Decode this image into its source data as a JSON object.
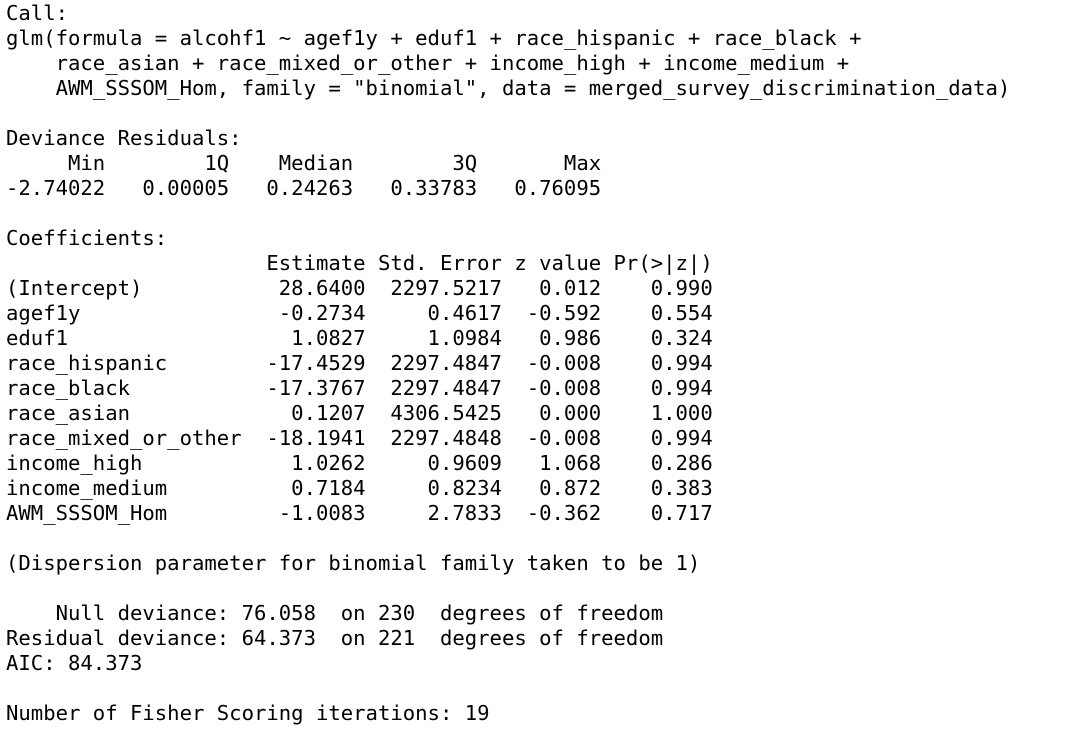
{
  "colors": {
    "background": "#ffffff",
    "text": "#000000"
  },
  "call": {
    "header": "Call:",
    "lines": [
      "glm(formula = alcohf1 ~ agef1y + eduf1 + race_hispanic + race_black + ",
      "    race_asian + race_mixed_or_other + income_high + income_medium + ",
      "    AWM_SSSOM_Hom, family = \"binomial\", data = merged_survey_discrimination_data)"
    ]
  },
  "deviance_residuals": {
    "header": "Deviance Residuals: ",
    "labels_line": "     Min        1Q    Median        3Q       Max  ",
    "values_line": "-2.74022   0.00005   0.24263   0.33783   0.76095  ",
    "labels": [
      "Min",
      "1Q",
      "Median",
      "3Q",
      "Max"
    ],
    "values": [
      "-2.74022",
      "0.00005",
      "0.24263",
      "0.33783",
      "0.76095"
    ]
  },
  "coefficients": {
    "header": "Coefficients:",
    "columns_line": "                     Estimate Std. Error z value Pr(>|z|)",
    "columns": [
      "Estimate",
      "Std. Error",
      "z value",
      "Pr(>|z|)"
    ],
    "rows": [
      {
        "line": "(Intercept)           28.6400  2297.5217   0.012    0.990",
        "term": "(Intercept)",
        "estimate": "28.6400",
        "std_error": "2297.5217",
        "z_value": "0.012",
        "p_value": "0.990"
      },
      {
        "line": "agef1y                -0.2734     0.4617  -0.592    0.554",
        "term": "agef1y",
        "estimate": "-0.2734",
        "std_error": "0.4617",
        "z_value": "-0.592",
        "p_value": "0.554"
      },
      {
        "line": "eduf1                  1.0827     1.0984   0.986    0.324",
        "term": "eduf1",
        "estimate": "1.0827",
        "std_error": "1.0984",
        "z_value": "0.986",
        "p_value": "0.324"
      },
      {
        "line": "race_hispanic        -17.4529  2297.4847  -0.008    0.994",
        "term": "race_hispanic",
        "estimate": "-17.4529",
        "std_error": "2297.4847",
        "z_value": "-0.008",
        "p_value": "0.994"
      },
      {
        "line": "race_black           -17.3767  2297.4847  -0.008    0.994",
        "term": "race_black",
        "estimate": "-17.3767",
        "std_error": "2297.4847",
        "z_value": "-0.008",
        "p_value": "0.994"
      },
      {
        "line": "race_asian             0.1207  4306.5425   0.000    1.000",
        "term": "race_asian",
        "estimate": "0.1207",
        "std_error": "4306.5425",
        "z_value": "0.000",
        "p_value": "1.000"
      },
      {
        "line": "race_mixed_or_other  -18.1941  2297.4848  -0.008    0.994",
        "term": "race_mixed_or_other",
        "estimate": "-18.1941",
        "std_error": "2297.4848",
        "z_value": "-0.008",
        "p_value": "0.994"
      },
      {
        "line": "income_high            1.0262     0.9609   1.068    0.286",
        "term": "income_high",
        "estimate": "1.0262",
        "std_error": "0.9609",
        "z_value": "1.068",
        "p_value": "0.286"
      },
      {
        "line": "income_medium          0.7184     0.8234   0.872    0.383",
        "term": "income_medium",
        "estimate": "0.7184",
        "std_error": "0.8234",
        "z_value": "0.872",
        "p_value": "0.383"
      },
      {
        "line": "AWM_SSSOM_Hom         -1.0083     2.7833  -0.362    0.717",
        "term": "AWM_SSSOM_Hom",
        "estimate": "-1.0083",
        "std_error": "2.7833",
        "z_value": "-0.362",
        "p_value": "0.717"
      }
    ]
  },
  "dispersion_note": "(Dispersion parameter for binomial family taken to be 1)",
  "fit": {
    "null_deviance_line": "    Null deviance: 76.058  on 230  degrees of freedom",
    "residual_deviance_line": "Residual deviance: 64.373  on 221  degrees of freedom",
    "aic_line": "AIC: 84.373",
    "null_deviance": "76.058",
    "null_df": "230",
    "residual_deviance": "64.373",
    "residual_df": "221",
    "aic": "84.373"
  },
  "iterations_line": "Number of Fisher Scoring iterations: 19"
}
